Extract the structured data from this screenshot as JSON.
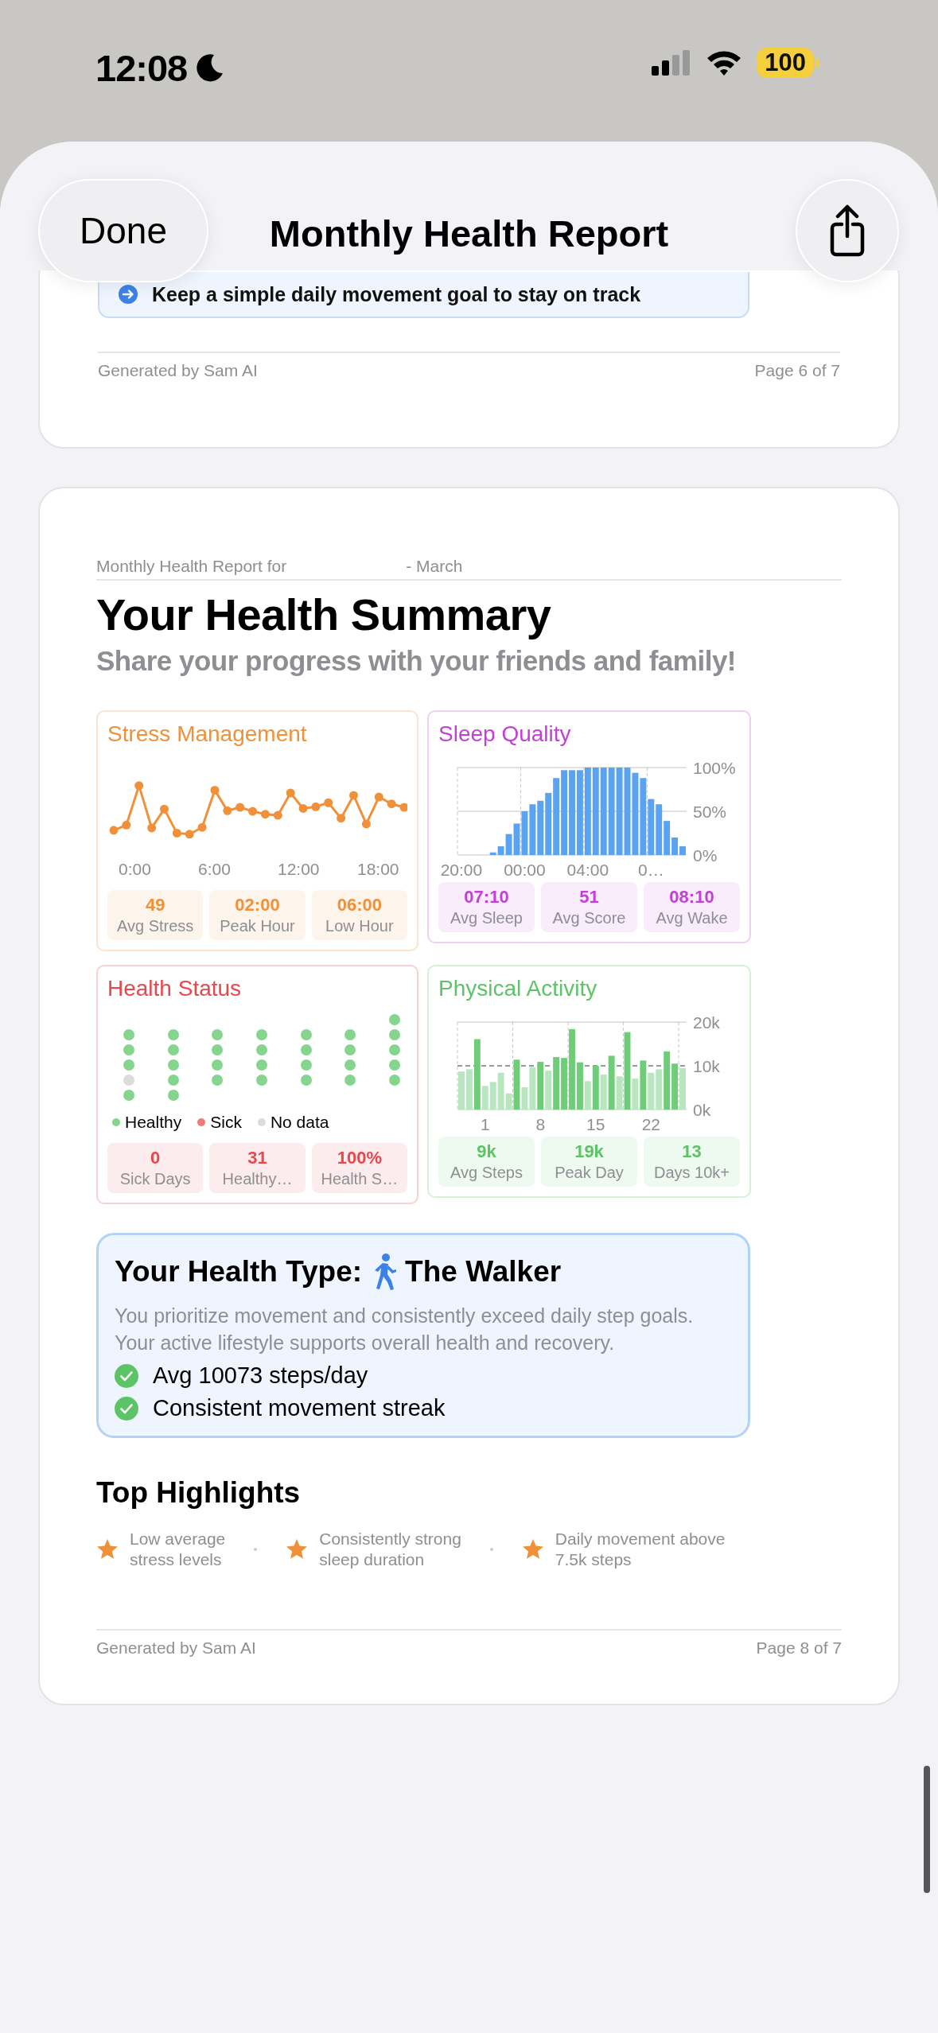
{
  "status_bar": {
    "time": "12:08",
    "battery": "100"
  },
  "header": {
    "done": "Done",
    "title": "Monthly Health Report"
  },
  "previous_page": {
    "tip": "Keep a simple daily movement goal to stay on track",
    "footer_left": "Generated by Sam AI",
    "footer_right": "Page 6 of 7"
  },
  "page": {
    "report_for": "Monthly Health Report for",
    "month": "- March",
    "title": "Your Health Summary",
    "subtitle": "Share your progress with your friends and family!",
    "cards": [
      {
        "kind": "line",
        "title": "Stress Management",
        "color": "#f0913a",
        "xlabels": [
          "0:00",
          "6:00",
          "12:00",
          "18:00"
        ],
        "stats": [
          {
            "value": "49",
            "label": "Avg Stress"
          },
          {
            "value": "02:00",
            "label": "Peak Hour"
          },
          {
            "value": "06:00",
            "label": "Low Hour"
          }
        ]
      },
      {
        "kind": "bar",
        "title": "Sleep Quality",
        "color": "#c340d6",
        "chart_data": {
          "type": "bar",
          "categories": [
            "20:00",
            null,
            null,
            null,
            null,
            null,
            null,
            null,
            "00:00",
            null,
            null,
            null,
            null,
            null,
            null,
            null,
            "04:00",
            null,
            null,
            null,
            null,
            null,
            null,
            null,
            "0…",
            null,
            null,
            null,
            null
          ],
          "series": [
            {
              "color": "#5aa2f2",
              "values": [
                0,
                0,
                0,
                0,
                3,
                10,
                24,
                36,
                50,
                58,
                62,
                71,
                88,
                97,
                97,
                97,
                100,
                100,
                100,
                100,
                100,
                100,
                94,
                88,
                64,
                58,
                39,
                20,
                10
              ]
            }
          ],
          "ylim": [
            0,
            100
          ],
          "yticks": [
            {
              "value": 0,
              "label": "0%"
            },
            {
              "value": 50,
              "label": "50%"
            },
            {
              "value": 100,
              "label": "100%"
            }
          ],
          "ref_lines": [
            {
              "axis": "y",
              "value": 50
            }
          ]
        },
        "stats": [
          {
            "value": "07:10",
            "label": "Avg Sleep"
          },
          {
            "value": "51",
            "label": "Avg Score"
          },
          {
            "value": "08:10",
            "label": "Avg Wake"
          }
        ]
      },
      {
        "kind": "dots",
        "title": "Health Status",
        "color": "#e5484d",
        "days": [
          {
            "color": "#86d58e"
          },
          {
            "color": "#86d58e"
          },
          {
            "color": "#86d58e"
          },
          {
            "color": "#86d58e"
          },
          {
            "color": "#86d58e"
          },
          {
            "color": "#86d58e"
          },
          {
            "color": "#86d58e"
          },
          {
            "color": "#86d58e"
          },
          {
            "color": "#86d58e"
          },
          {
            "color": "#86d58e"
          },
          {
            "color": "#86d58e"
          },
          {
            "color": "#86d58e"
          },
          {
            "color": "#86d58e"
          },
          {
            "color": "#86d58e"
          },
          {
            "color": "#86d58e"
          },
          {
            "color": "#86d58e"
          },
          {
            "color": "#86d58e"
          },
          {
            "color": "#86d58e"
          },
          {
            "color": "#86d58e"
          },
          {
            "color": "#86d58e"
          },
          {
            "color": "#86d58e"
          },
          {
            "color": "#86d58e"
          },
          {
            "color": "#dcdcdc"
          },
          {
            "color": "#86d58e"
          },
          {
            "color": "#86d58e"
          },
          {
            "color": "#86d58e"
          },
          {
            "color": "#86d58e"
          },
          {
            "color": "#86d58e"
          },
          {
            "color": "#86d58e"
          },
          {
            "color": "#86d58e"
          },
          {
            "color": "#86d58e"
          }
        ],
        "legend": [
          {
            "label": "Healthy",
            "color": "#86d58e"
          },
          {
            "label": "Sick",
            "color": "#ee7b78"
          },
          {
            "label": "No data",
            "color": "#dcdcdc"
          }
        ],
        "stats": [
          {
            "value": "0",
            "label": "Sick Days"
          },
          {
            "value": "31",
            "label": "Healthy…"
          },
          {
            "value": "100%",
            "label": "Health S…"
          }
        ]
      },
      {
        "kind": "bar",
        "title": "Physical Activity",
        "color": "#5cc466",
        "chart_data": {
          "type": "bar",
          "stacked": true,
          "categories": [
            null,
            null,
            null,
            "1",
            null,
            null,
            null,
            null,
            null,
            null,
            "8",
            null,
            null,
            null,
            null,
            null,
            null,
            "15",
            null,
            null,
            null,
            null,
            null,
            null,
            "22",
            null,
            null,
            null,
            null
          ],
          "series": [
            {
              "color": "#6fcd7a",
              "values": [
                null,
                null,
                16.1,
                null,
                null,
                null,
                null,
                11.4,
                null,
                null,
                10.9,
                null,
                12.0,
                11.8,
                18.4,
                10.8,
                null,
                10.0,
                null,
                12.3,
                null,
                17.7,
                null,
                11.2,
                null,
                null,
                13.3,
                10.5,
                null
              ]
            },
            {
              "color": "#b8e6be",
              "values": [
                8.7,
                9.2,
                null,
                5.4,
                6.3,
                8.4,
                3.7,
                null,
                5.1,
                9.7,
                null,
                8.9,
                null,
                null,
                null,
                null,
                6.5,
                null,
                8.0,
                null,
                7.6,
                null,
                7.1,
                null,
                8.4,
                9.2,
                null,
                null,
                9.5
              ]
            }
          ],
          "ylim": [
            0,
            20
          ],
          "yticks": [
            {
              "value": 0,
              "label": "0k"
            },
            {
              "value": 10,
              "label": "10k"
            },
            {
              "value": 20,
              "label": "20k"
            }
          ],
          "ref_lines": [
            {
              "axis": "y",
              "value": 10
            }
          ]
        },
        "stats": [
          {
            "value": "9k",
            "label": "Avg Steps"
          },
          {
            "value": "19k",
            "label": "Peak Day"
          },
          {
            "value": "13",
            "label": "Days 10k+"
          }
        ]
      }
    ],
    "health_type": {
      "label": "Your Health Type:",
      "name": "The Walker",
      "description": "You prioritize movement and consistently exceed daily step goals. Your active lifestyle supports overall health and recovery.",
      "points": [
        "Avg 10073 steps/day",
        "Consistent movement streak"
      ]
    },
    "highlights": {
      "title": "Top Highlights",
      "items": [
        "Low average\nstress levels",
        "Consistently strong\nsleep duration",
        "Daily movement above\n7.5k steps"
      ]
    },
    "footer_left": "Generated by Sam AI",
    "footer_right": "Page 8 of 7"
  }
}
